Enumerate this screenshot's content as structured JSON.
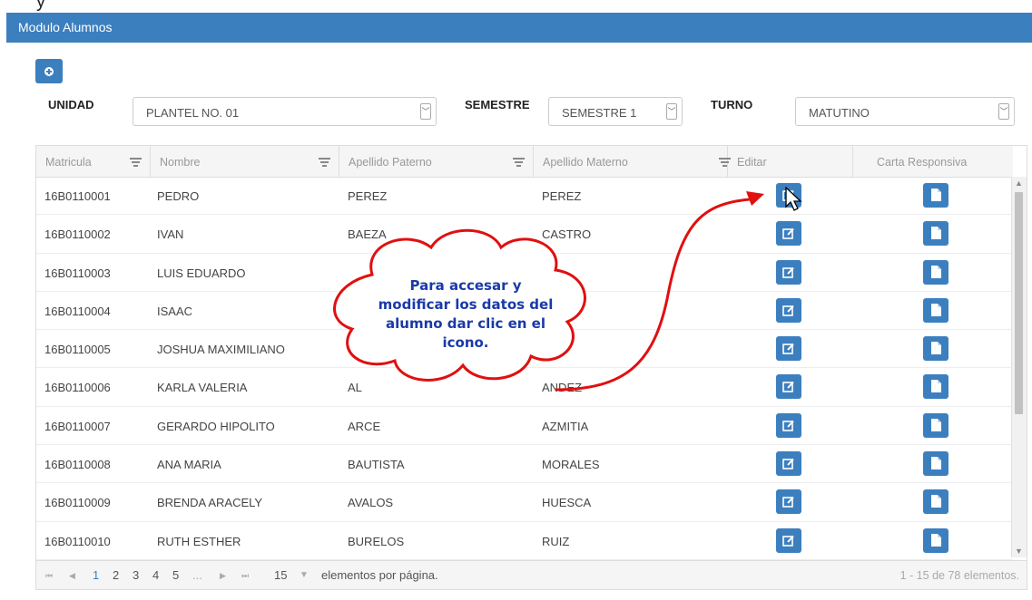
{
  "top_fragment": "y",
  "header": {
    "title": "Modulo Alumnos"
  },
  "filters": {
    "unidad_label": "UNIDAD",
    "unidad_value": "PLANTEL NO. 01",
    "semestre_label": "SEMESTRE",
    "semestre_value": "SEMESTRE 1",
    "turno_label": "TURNO",
    "turno_value": "MATUTINO"
  },
  "grid": {
    "columns": [
      "Matricula",
      "Nombre",
      "Apellido Paterno",
      "Apellido Materno",
      "Editar",
      "Carta Responsiva"
    ],
    "rows": [
      {
        "matricula": "16B0110001",
        "nombre": "PEDRO",
        "paterno": "PEREZ",
        "materno": "PEREZ"
      },
      {
        "matricula": "16B0110002",
        "nombre": "IVAN",
        "paterno": "BAEZA",
        "materno": "CASTRO"
      },
      {
        "matricula": "16B0110003",
        "nombre": "LUIS EDUARDO",
        "paterno": "",
        "materno": ""
      },
      {
        "matricula": "16B0110004",
        "nombre": "ISAAC",
        "paterno": "",
        "materno": ""
      },
      {
        "matricula": "16B0110005",
        "nombre": "JOSHUA MAXIMILIANO",
        "paterno": "",
        "materno": ""
      },
      {
        "matricula": "16B0110006",
        "nombre": "KARLA VALERIA",
        "paterno": "AL",
        "materno": "ANDEZ"
      },
      {
        "matricula": "16B0110007",
        "nombre": "GERARDO HIPOLITO",
        "paterno": "ARCE",
        "materno": "AZMITIA"
      },
      {
        "matricula": "16B0110008",
        "nombre": "ANA MARIA",
        "paterno": "BAUTISTA",
        "materno": "MORALES"
      },
      {
        "matricula": "16B0110009",
        "nombre": "BRENDA ARACELY",
        "paterno": "AVALOS",
        "materno": "HUESCA"
      },
      {
        "matricula": "16B0110010",
        "nombre": "RUTH ESTHER",
        "paterno": "BURELOS",
        "materno": "RUIZ"
      }
    ]
  },
  "pager": {
    "first": "⏮",
    "prev": "◀",
    "pages": [
      "1",
      "2",
      "3",
      "4",
      "5",
      "..."
    ],
    "next": "▶",
    "last": "⏭",
    "page_size": "15",
    "page_size_label": "elementos por página.",
    "info": "1 - 15 de 78 elementos."
  },
  "callout": {
    "lines": [
      "Para accesar y",
      "modificar los datos del",
      "alumno dar clic en el",
      "icono."
    ]
  },
  "colors": {
    "accent": "#3c7fbf",
    "callout_text": "#1a3aa8",
    "arrow": "#e01010"
  }
}
